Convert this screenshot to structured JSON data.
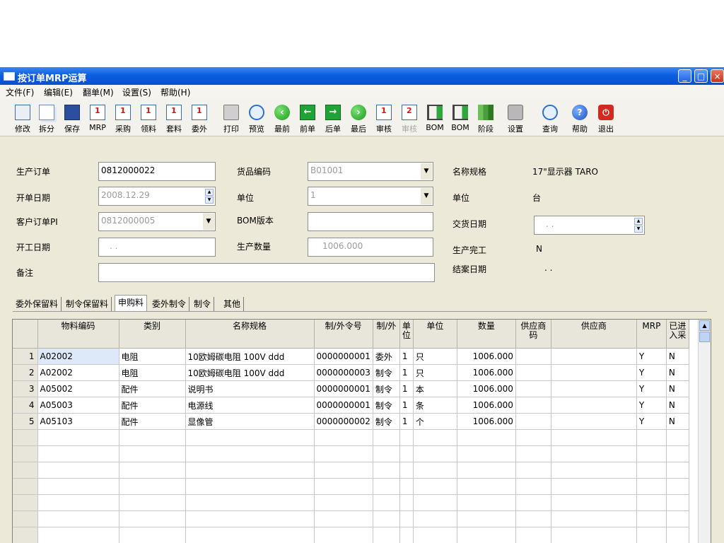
{
  "window": {
    "title": "按订单MRP运算"
  },
  "menu": [
    "文件(F)",
    "编辑(E)",
    "翻单(M)",
    "设置(S)",
    "帮助(H)"
  ],
  "toolbar": [
    {
      "label": "修改",
      "icon": "edit-icon"
    },
    {
      "label": "拆分",
      "icon": "split-icon"
    },
    {
      "label": "保存",
      "icon": "save-icon"
    },
    {
      "label": "MRP",
      "icon": "doc-icon"
    },
    {
      "label": "采购",
      "icon": "doc-icon"
    },
    {
      "label": "领料",
      "icon": "doc-icon"
    },
    {
      "label": "套料",
      "icon": "doc-icon"
    },
    {
      "label": "委外",
      "icon": "doc-icon"
    },
    {
      "label": "打印",
      "icon": "print-icon"
    },
    {
      "label": "预览",
      "icon": "preview-icon"
    },
    {
      "label": "最前",
      "icon": "first-icon"
    },
    {
      "label": "前单",
      "icon": "prev-icon"
    },
    {
      "label": "后单",
      "icon": "next-icon"
    },
    {
      "label": "最后",
      "icon": "last-icon"
    },
    {
      "label": "审核",
      "icon": "approve-icon"
    },
    {
      "label": "审核",
      "icon": "unapprove-icon",
      "disabled": true
    },
    {
      "label": "BOM",
      "icon": "bom-icon"
    },
    {
      "label": "BOM",
      "icon": "bom-icon"
    },
    {
      "label": "阶段",
      "icon": "stage-icon"
    },
    {
      "label": "设置",
      "icon": "settings-icon"
    },
    {
      "label": "查询",
      "icon": "search-icon"
    },
    {
      "label": "帮助",
      "icon": "help-icon"
    },
    {
      "label": "退出",
      "icon": "exit-icon"
    }
  ],
  "form": {
    "production_order": {
      "label": "生产订单",
      "value": "0812000022"
    },
    "open_date": {
      "label": "开单日期",
      "value": "2008.12.29"
    },
    "customer_pi": {
      "label": "客户订单PI",
      "value": "0812000005"
    },
    "start_date": {
      "label": "开工日期",
      "value": ". ."
    },
    "remarks": {
      "label": "备注",
      "value": ""
    },
    "item_code": {
      "label": "货品编码",
      "value": "B01001"
    },
    "unit": {
      "label": "单位",
      "value": "1"
    },
    "bom_version": {
      "label": "BOM版本",
      "value": ""
    },
    "production_qty": {
      "label": "生产数量",
      "value": "1006.000"
    },
    "name_spec": {
      "label": "名称规格",
      "value": "17\"显示器    TARO"
    },
    "unit2": {
      "label": "单位",
      "value": "台"
    },
    "delivery_date": {
      "label": "交货日期",
      "value": ". ."
    },
    "production_done": {
      "label": "生产完工",
      "value": "N"
    },
    "close_date": {
      "label": "结案日期",
      "value": ". ."
    }
  },
  "tabs": [
    "委外保留料",
    "制令保留料",
    "申购料",
    "委外制令",
    "制令",
    "其他"
  ],
  "active_tab": 2,
  "grid": {
    "columns": [
      "物料编码",
      "类别",
      "名称规格",
      "制/外令号",
      "制/外",
      "单位",
      "单位",
      "数量",
      "供应商码",
      "供应商",
      "MRP",
      "已进入采"
    ],
    "column_display": [
      "物料编码",
      "类别",
      "名称规格",
      "制/外令号",
      "制/外",
      "单\n位",
      "单位",
      "数量",
      "供应商\n码",
      "供应商",
      "MRP",
      "已进\n入采"
    ],
    "rows": [
      [
        "1",
        "A02002",
        "电阻",
        "10欧姆碳电阻 100V    ddd",
        "0000000001",
        "委外",
        "1",
        "只",
        "1006.000",
        "",
        "",
        "Y",
        "N"
      ],
      [
        "2",
        "A02002",
        "电阻",
        "10欧姆碳电阻 100V    ddd",
        "0000000003",
        "制令",
        "1",
        "只",
        "1006.000",
        "",
        "",
        "Y",
        "N"
      ],
      [
        "3",
        "A05002",
        "配件",
        "说明书",
        "0000000001",
        "制令",
        "1",
        "本",
        "1006.000",
        "",
        "",
        "Y",
        "N"
      ],
      [
        "4",
        "A05003",
        "配件",
        "电源线",
        "0000000001",
        "制令",
        "1",
        "条",
        "1006.000",
        "",
        "",
        "Y",
        "N"
      ],
      [
        "5",
        "A05103",
        "配件",
        "显像管",
        "0000000002",
        "制令",
        "1",
        "个",
        "1006.000",
        "",
        "",
        "Y",
        "N"
      ]
    ],
    "empty_rows": 8
  }
}
